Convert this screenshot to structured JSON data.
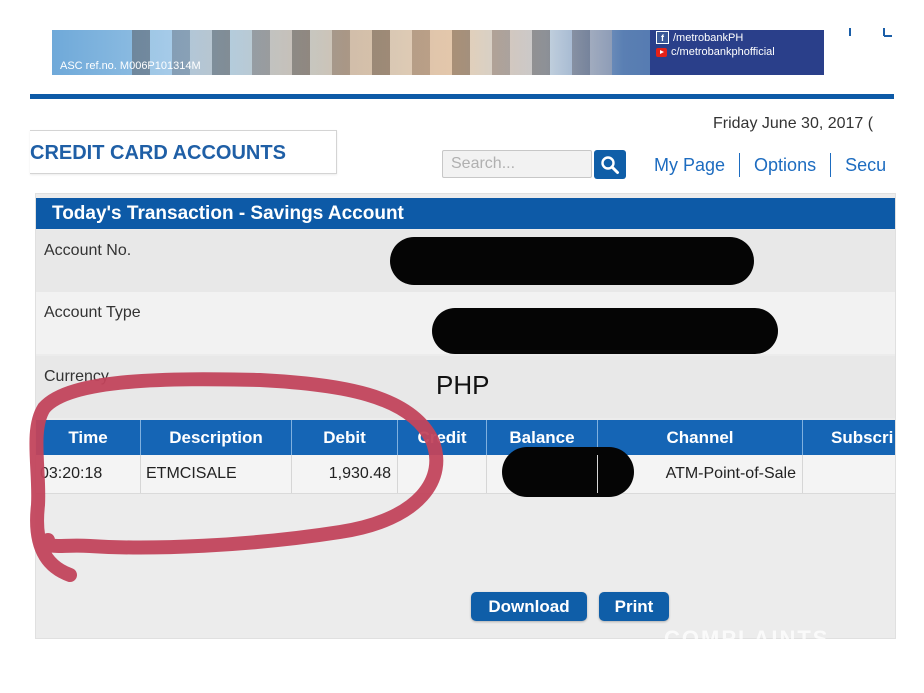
{
  "banner": {
    "asc_ref": "ASC ref.no. M006P101314M",
    "facebook_handle": "/metrobankPH",
    "youtube_handle": "c/metrobankphofficial"
  },
  "nav": {
    "date": "Friday June 30, 2017 (",
    "section_title": "CREDIT CARD ACCOUNTS",
    "search_placeholder": "Search...",
    "links": [
      "My Page",
      "Options",
      "Secu"
    ]
  },
  "panel": {
    "title": "Today's Transaction - Savings Account",
    "fields": {
      "account_no_label": "Account No.",
      "account_type_label": "Account Type",
      "currency_label": "Currency",
      "currency_value": "PHP"
    },
    "table": {
      "headers": [
        "Time",
        "Description",
        "Debit",
        "Credit",
        "Balance",
        "Channel",
        "Subscri"
      ],
      "rows": [
        {
          "time": "03:20:18",
          "description": "ETMCISALE",
          "debit": "1,930.48",
          "credit": "",
          "balance": "",
          "channel": "ATM-Point-of-Sale",
          "subscriber": ""
        }
      ]
    },
    "buttons": {
      "download": "Download",
      "print": "Print"
    },
    "watermark": "COMPLAINTS"
  },
  "colors": {
    "brand_blue": "#0d5aa7",
    "link_blue": "#1d6cc0",
    "annotation_red": "#c2455c"
  }
}
